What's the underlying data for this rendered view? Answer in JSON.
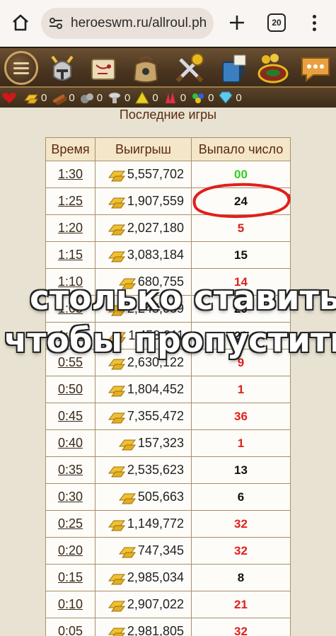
{
  "browser": {
    "url": "heroeswm.ru/allroul.ph",
    "tab_count": "20"
  },
  "nav": {
    "icons": [
      "menu-icon",
      "knight-helmet-icon",
      "map-scroll-icon",
      "bag-icon",
      "crossed-swords-trophy-icon",
      "tavern-mug-icon",
      "roulette-icon",
      "chat-icon"
    ]
  },
  "resources": [
    {
      "name": "health-icon",
      "value": ""
    },
    {
      "name": "gold-icon",
      "value": "0"
    },
    {
      "name": "wood-icon",
      "value": "0"
    },
    {
      "name": "ore-icon",
      "value": "0"
    },
    {
      "name": "mercury-icon",
      "value": "0"
    },
    {
      "name": "sulfur-icon",
      "value": "0"
    },
    {
      "name": "crystal-icon",
      "value": "0"
    },
    {
      "name": "gems-icon",
      "value": "0"
    },
    {
      "name": "diamond-icon",
      "value": "0"
    }
  ],
  "section_title": "Последние игры",
  "table": {
    "headers": [
      "Время",
      "Выигрыш",
      "Выпало число"
    ],
    "rows": [
      {
        "time": "1:30",
        "win": "5,557,702",
        "num": "00",
        "color": "green"
      },
      {
        "time": "1:25",
        "win": "1,907,559",
        "num": "24",
        "color": "black"
      },
      {
        "time": "1:20",
        "win": "2,027,180",
        "num": "5",
        "color": "red"
      },
      {
        "time": "1:15",
        "win": "3,083,184",
        "num": "15",
        "color": "black"
      },
      {
        "time": "1:10",
        "win": "680,755",
        "num": "14",
        "color": "red"
      },
      {
        "time": "1:05",
        "win": "2,245,039",
        "num": "29",
        "color": "black"
      },
      {
        "time": "1:01",
        "win": "1,453,911",
        "num": "28",
        "color": "black"
      },
      {
        "time": "0:55",
        "win": "2,630,122",
        "num": "9",
        "color": "red"
      },
      {
        "time": "0:50",
        "win": "1,804,452",
        "num": "1",
        "color": "red"
      },
      {
        "time": "0:45",
        "win": "7,355,472",
        "num": "36",
        "color": "red"
      },
      {
        "time": "0:40",
        "win": "157,323",
        "num": "1",
        "color": "red"
      },
      {
        "time": "0:35",
        "win": "2,535,623",
        "num": "13",
        "color": "black"
      },
      {
        "time": "0:30",
        "win": "505,663",
        "num": "6",
        "color": "black"
      },
      {
        "time": "0:25",
        "win": "1,149,772",
        "num": "32",
        "color": "red"
      },
      {
        "time": "0:20",
        "win": "747,345",
        "num": "32",
        "color": "red"
      },
      {
        "time": "0:15",
        "win": "2,985,034",
        "num": "8",
        "color": "black"
      },
      {
        "time": "0:10",
        "win": "2,907,022",
        "num": "21",
        "color": "red"
      },
      {
        "time": "0:05",
        "win": "2,981,805",
        "num": "32",
        "color": "red"
      }
    ]
  },
  "overlay": {
    "line1": "столько ставить",
    "line2": "чтобы пропустить"
  },
  "colors": {
    "red": "#e0201c",
    "black": "#111111",
    "green": "#30d020",
    "annotation": "#e0201c"
  }
}
